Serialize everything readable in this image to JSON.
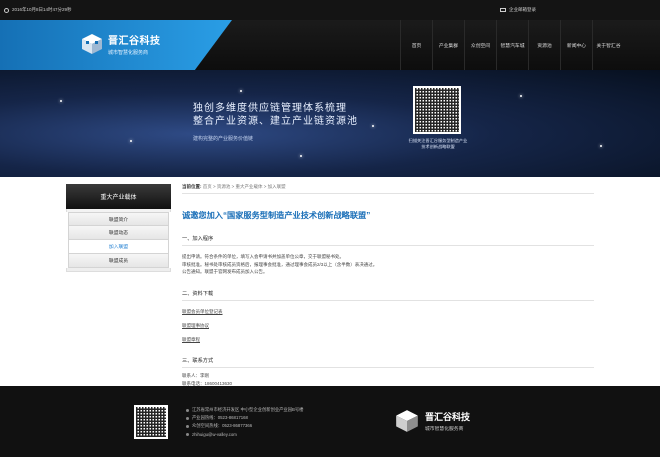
{
  "topbar": {
    "datetime": "2016年10月8日14时47分29秒",
    "mail_login": "企业邮箱登录"
  },
  "logo": {
    "name": "晋汇谷科技",
    "tagline": "城市智慧化服务商"
  },
  "nav": {
    "items": [
      "首页",
      "产业集群",
      "众创空间",
      "智慧汽车城",
      "资源池",
      "新闻中心",
      "关于智汇谷"
    ]
  },
  "banner": {
    "line1": "独创多维度供应链管理体系梳理",
    "line2": "整合产业资源、建立产业链资源池",
    "line3": "建构完整的产业服务价值链",
    "qr_caption": "扫描关注晋汇谷服务型制造产业技术创新战略联盟"
  },
  "sidebar": {
    "title": "重大产业载体",
    "items": [
      {
        "label": "联盟简介",
        "active": false
      },
      {
        "label": "联盟动态",
        "active": false
      },
      {
        "label": "加入联盟",
        "active": true
      },
      {
        "label": "联盟成员",
        "active": false
      }
    ]
  },
  "breadcrumb": {
    "prefix": "当前位置:",
    "path": "首页 > 资源池 > 重大产业载体 > 加入联盟"
  },
  "content": {
    "title": "诚邀您加入“国家服务型制造产业技术创新战略联盟”",
    "section1": "一、加入程序",
    "para1": "提出申请。符合条件的单位，填写入会申请书并加盖单位公章，交于联盟秘书处。",
    "para2": "审核批准。秘书处审核成员资格后，报理事会批准，通过理事会成员2/3以上（含半数）表决通过。",
    "para3": "公告通知。联盟于官网发布成员加入公告。",
    "section2": "二、资料下载",
    "downloads": [
      "联盟会员单位登记表",
      "联盟理事协议",
      "联盟章程"
    ],
    "section3": "三、联系方式",
    "contact_person": "联系人：李刚",
    "contact_phone": "联系电话：18600413630",
    "contact_email_label": "联系邮箱：",
    "contact_email": "service@csm-alliance.org",
    "contact_unit": "秘书处"
  },
  "footer": {
    "address": "江苏省常州市经济开发区 中小型企业创新创业产业园B号楼",
    "phone": "产业园热线：0523-86817168",
    "tel": "众创空间热线：0523-86877366",
    "email": "zhihuigu@w-valley.com",
    "logo_name": "晋汇谷科技",
    "logo_tagline": "城市智慧化服务商"
  },
  "colors": {
    "accent_blue": "#1a6fb8",
    "header_blue": "#2a9ee6",
    "dark": "#111111"
  }
}
